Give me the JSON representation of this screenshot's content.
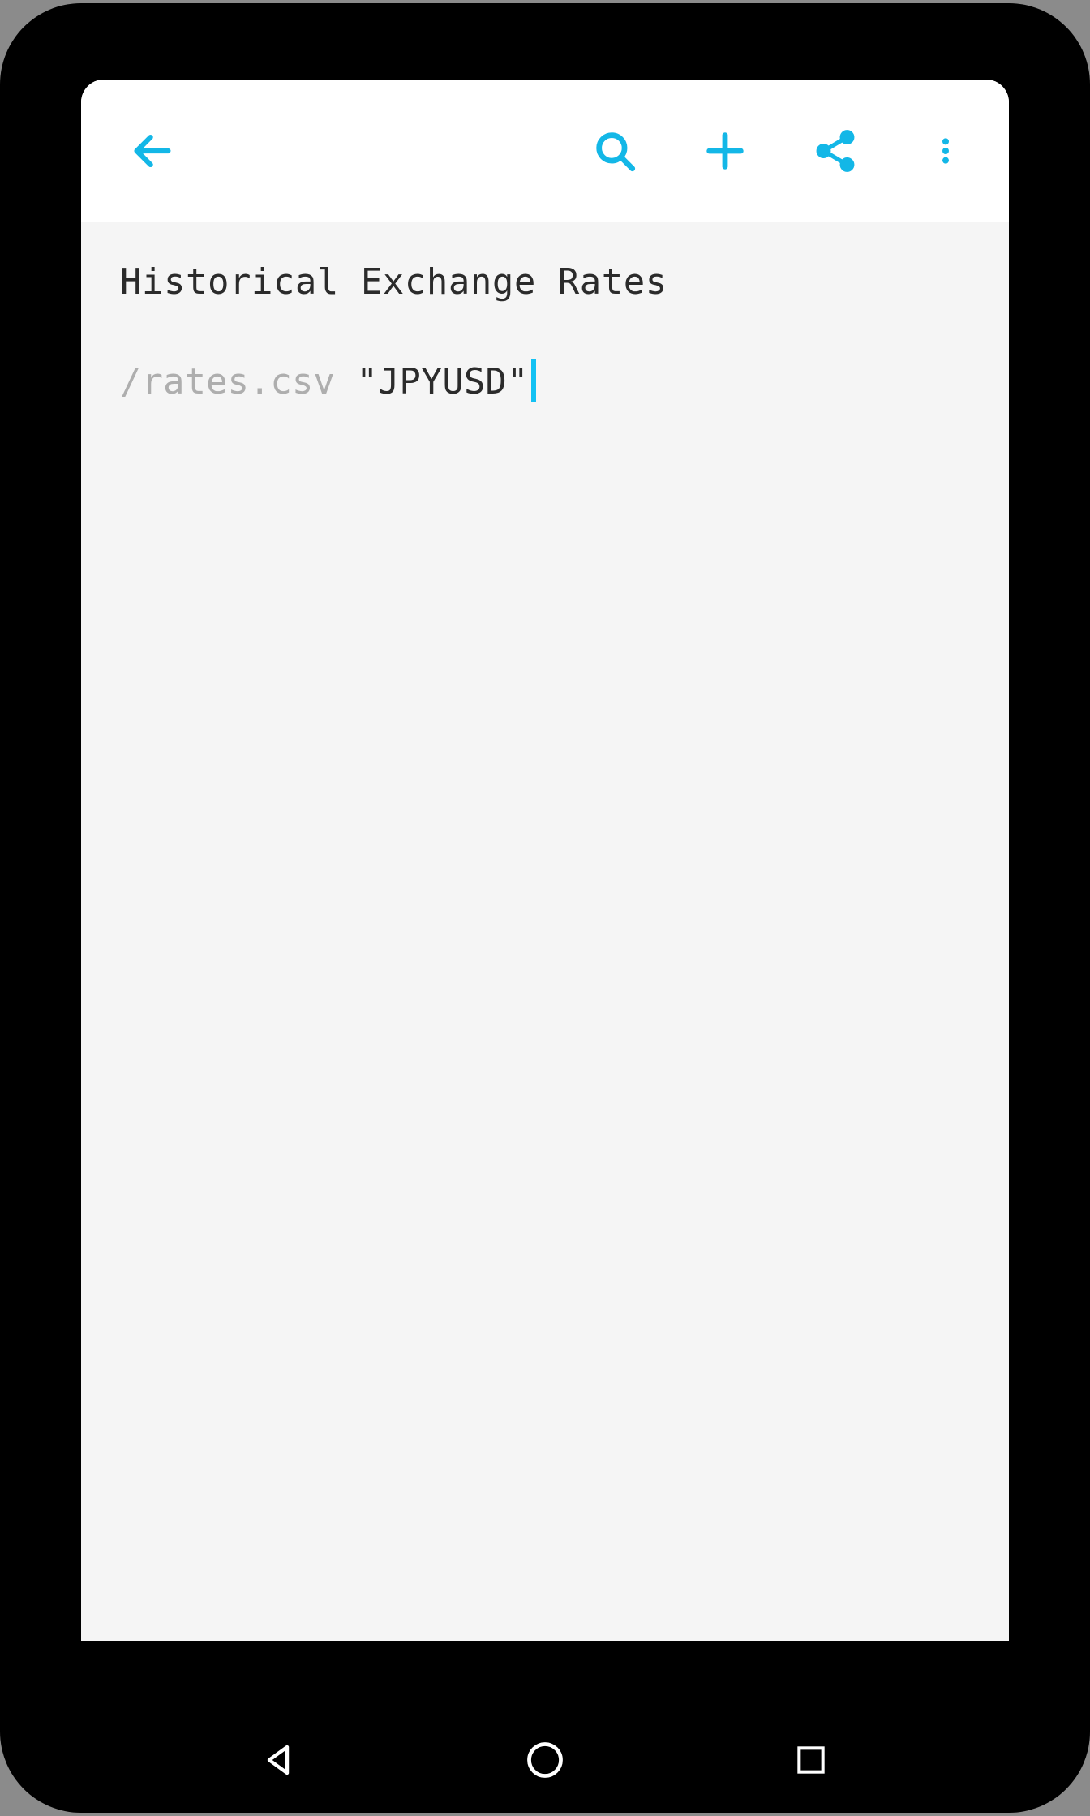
{
  "accent": "#13b7e7",
  "document": {
    "title": "Historical Exchange Rates",
    "command_hint": "/rates.csv",
    "command_arg": "\"JPYUSD\""
  },
  "toolbar": {
    "back_label": "Back",
    "search_label": "Search",
    "add_label": "Add",
    "share_label": "Share",
    "more_label": "More options"
  },
  "nav": {
    "back_label": "Back",
    "home_label": "Home",
    "recent_label": "Recent apps"
  }
}
